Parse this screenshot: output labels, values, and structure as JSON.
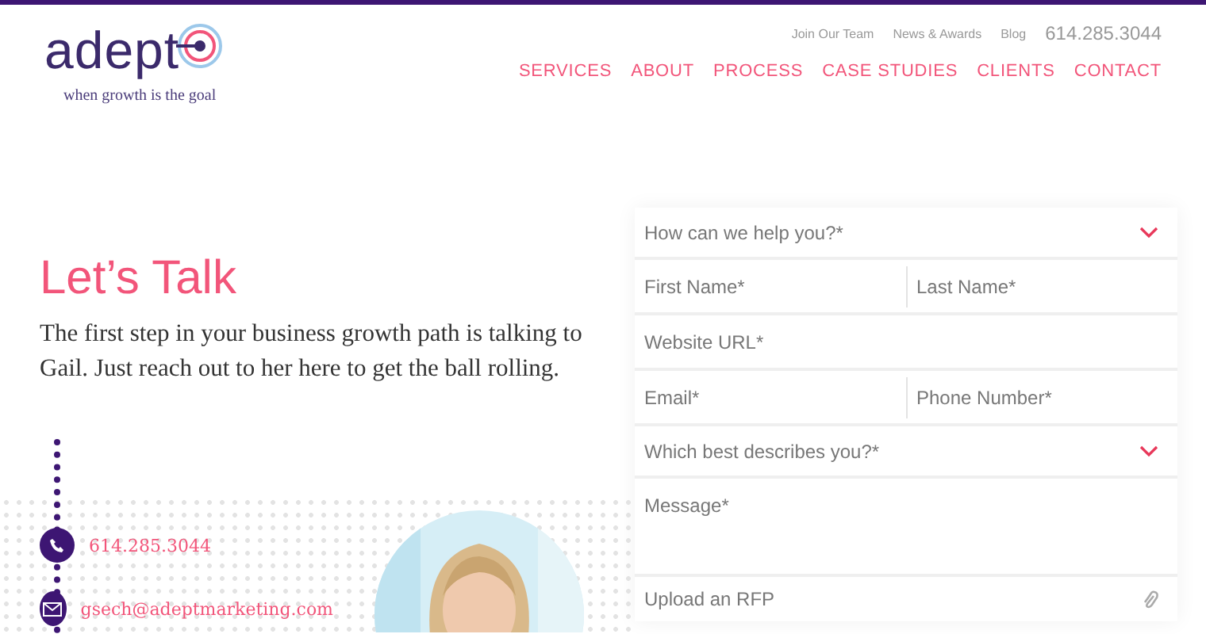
{
  "header": {
    "logo": {
      "wordmark": "adept",
      "tagline": "when growth is the goal"
    },
    "utility_links": [
      "Join Our Team",
      "News & Awards",
      "Blog"
    ],
    "phone": "614.285.3044",
    "nav": [
      {
        "label": "SERVICES",
        "selected": false
      },
      {
        "label": "ABOUT",
        "selected": false
      },
      {
        "label": "PROCESS",
        "selected": false
      },
      {
        "label": "CASE STUDIES",
        "selected": false
      },
      {
        "label": "CLIENTS",
        "selected": false
      },
      {
        "label": "CONTACT",
        "selected": false
      }
    ]
  },
  "intro": {
    "title": "Let’s Talk",
    "text": "The first step in your business growth path is talking to Gail. Just reach out to her here to get the ball rolling."
  },
  "contacts": [
    {
      "kind": "phone",
      "text": "614.285.3044"
    },
    {
      "kind": "email",
      "text": "gsech@adeptmarketing.com"
    }
  ],
  "form": {
    "rows": [
      {
        "fields": [
          {
            "kind": "select",
            "placeholder": "How can we help you?*"
          }
        ]
      },
      {
        "fields": [
          {
            "kind": "text",
            "placeholder": "First Name*"
          },
          {
            "kind": "text",
            "placeholder": "Last Name*"
          }
        ]
      },
      {
        "fields": [
          {
            "kind": "text",
            "placeholder": "Website URL*"
          }
        ]
      },
      {
        "fields": [
          {
            "kind": "text",
            "placeholder": "Email*"
          },
          {
            "kind": "text",
            "placeholder": "Phone Number*"
          }
        ]
      },
      {
        "fields": [
          {
            "kind": "select",
            "placeholder": "Which best describes you?*"
          }
        ]
      },
      {
        "fields": [
          {
            "kind": "textarea",
            "placeholder": "Message*"
          }
        ]
      },
      {
        "fields": [
          {
            "kind": "upload",
            "placeholder": "Upload an RFP"
          }
        ]
      }
    ]
  }
}
